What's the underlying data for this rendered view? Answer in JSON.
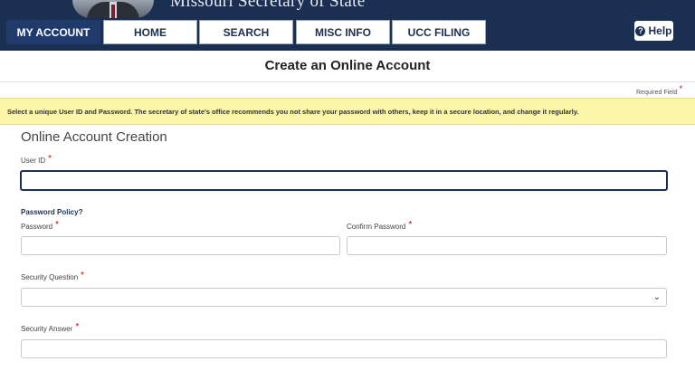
{
  "banner": {
    "site_title": "Missouri Secretary of State"
  },
  "nav": {
    "tabs": [
      {
        "label": "MY ACCOUNT"
      },
      {
        "label": "HOME"
      },
      {
        "label": "SEARCH"
      },
      {
        "label": "MISC INFO"
      },
      {
        "label": "UCC FILING"
      }
    ],
    "help_label": "Help"
  },
  "page": {
    "title": "Create an Online Account",
    "required_note": "Required Field",
    "notice": "Select a unique User ID and Password. The secretary of state's office recommends you not share your password with others, keep it in a secure location, and change it regularly.",
    "section_title": "Online Account Creation"
  },
  "form": {
    "user_id_label": "User ID",
    "user_id_value": "",
    "password_policy_label": "Password Policy?",
    "password_label": "Password",
    "confirm_password_label": "Confirm Password",
    "security_question_label": "Security Question",
    "security_question_value": "",
    "security_answer_label": "Security Answer",
    "required_star": "*"
  },
  "colors": {
    "navy": "#1b2f52",
    "notice_bg": "#fbf5a8",
    "required": "#cc0000"
  },
  "icons": {
    "help": "question-circle-icon",
    "select": "chevron-down-icon"
  }
}
